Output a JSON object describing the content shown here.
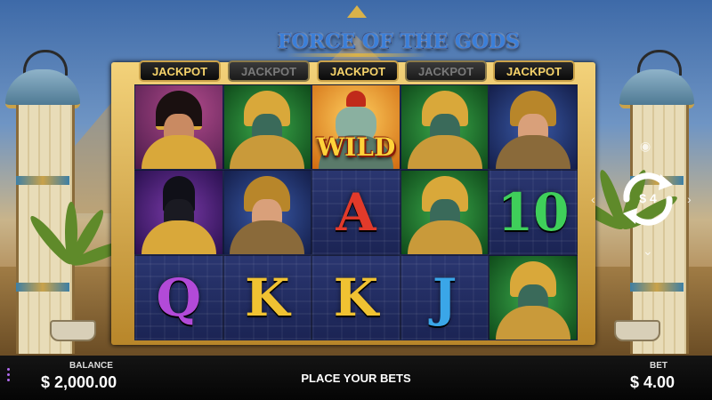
{
  "game": {
    "logo_text": "FORCE OF THE GODS"
  },
  "jackpots": [
    {
      "label": "JACKPOT",
      "active": true
    },
    {
      "label": "JACKPOT",
      "active": false
    },
    {
      "label": "JACKPOT",
      "active": true
    },
    {
      "label": "JACKPOT",
      "active": false
    },
    {
      "label": "JACKPOT",
      "active": true
    }
  ],
  "reels": {
    "rows": [
      [
        "queen-portrait",
        "green-god-portrait",
        "falcon-wild",
        "green-god-portrait",
        "warrior-woman-portrait"
      ],
      [
        "anubis-portrait",
        "warrior-woman-portrait",
        "A",
        "green-god-portrait",
        "10"
      ],
      [
        "Q",
        "K",
        "K",
        "J",
        "green-god-portrait"
      ]
    ],
    "wild_label": "WILD"
  },
  "spin": {
    "autoplay_count": "$ 4"
  },
  "footer": {
    "balance_label": "BALANCE",
    "balance_value": "$ 2,000.00",
    "status_text": "PLACE YOUR BETS",
    "bet_label": "BET",
    "bet_value": "$ 4.00"
  },
  "colors": {
    "letter_A": "#e23a2a",
    "letter_10": "#3fcf5a",
    "letter_Q": "#b24ad8",
    "letter_K": "#f0c232",
    "letter_J": "#3aa6e8",
    "menu_accent": "#b26cf0"
  }
}
